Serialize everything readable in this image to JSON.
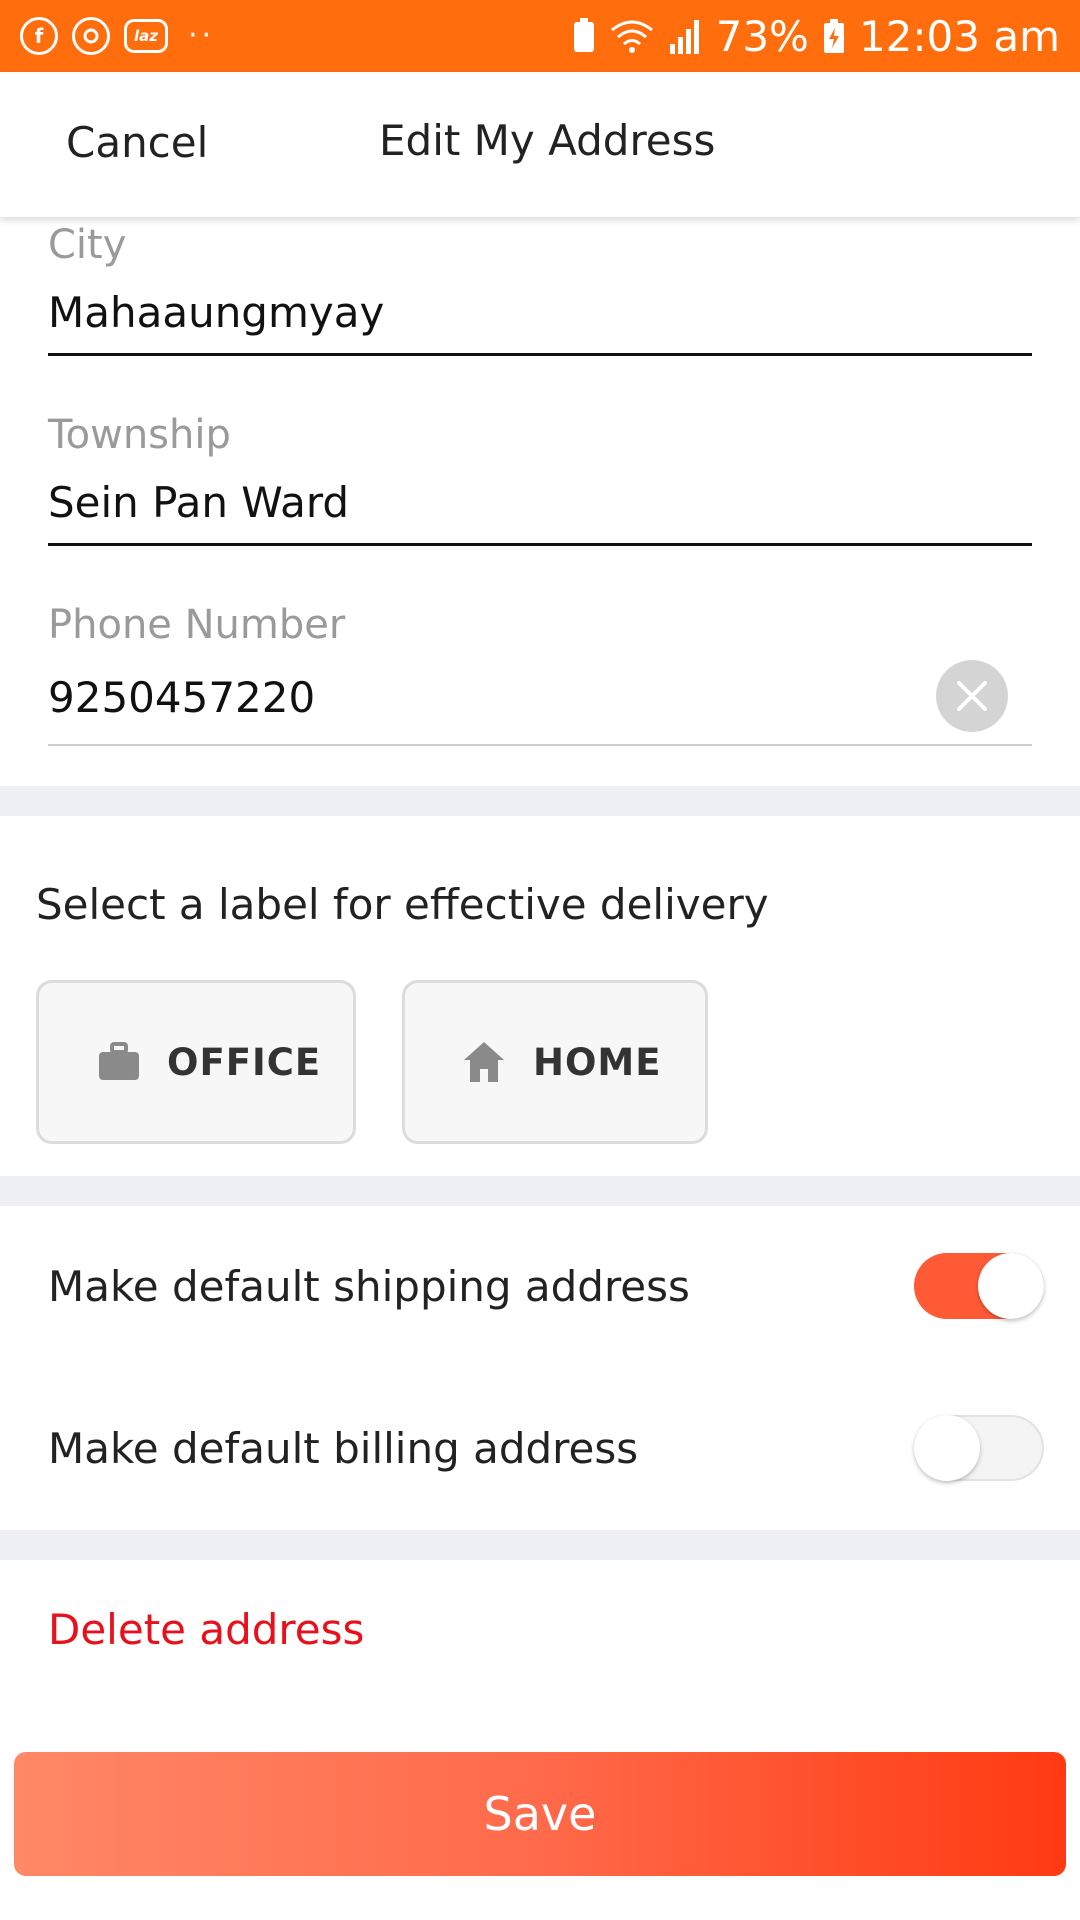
{
  "status_bar": {
    "left_icons": [
      "facebook-icon",
      "sync-icon",
      "lazada-icon"
    ],
    "laz_text": "laz",
    "dots": "··",
    "battery_percent": "73%",
    "time": "12:03 am"
  },
  "header": {
    "cancel_label": "Cancel",
    "title": "Edit My Address"
  },
  "form": {
    "city": {
      "label": "City",
      "value": "Mahaaungmyay"
    },
    "township": {
      "label": "Township",
      "value": "Sein Pan Ward"
    },
    "phone": {
      "label": "Phone Number",
      "value": "9250457220"
    }
  },
  "delivery_label": {
    "prompt": "Select a label for effective delivery",
    "options": [
      {
        "label": "OFFICE",
        "icon": "briefcase-icon"
      },
      {
        "label": "HOME",
        "icon": "home-icon"
      }
    ]
  },
  "toggles": {
    "shipping": {
      "label": "Make default shipping address",
      "on": true
    },
    "billing": {
      "label": "Make default billing address",
      "on": false
    }
  },
  "delete_label": "Delete address",
  "save_label": "Save",
  "colors": {
    "status_bar": "#ff6d0c",
    "accent": "#ff5a36",
    "delete": "#e8101a",
    "divider": "#eef0f5"
  }
}
